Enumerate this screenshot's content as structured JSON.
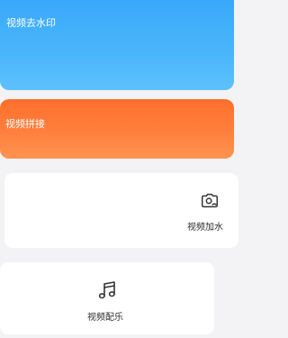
{
  "cards": {
    "watermark_removal": {
      "label": "视频去水印",
      "color": "#3FAEFA"
    },
    "video_splice": {
      "label": "视频拼接",
      "color": "#FF7A34"
    },
    "add_watermark": {
      "label": "视频加水",
      "icon": "camera-watermark-icon"
    },
    "video_music": {
      "label": "视频配乐",
      "icon": "music-note-icon"
    }
  }
}
